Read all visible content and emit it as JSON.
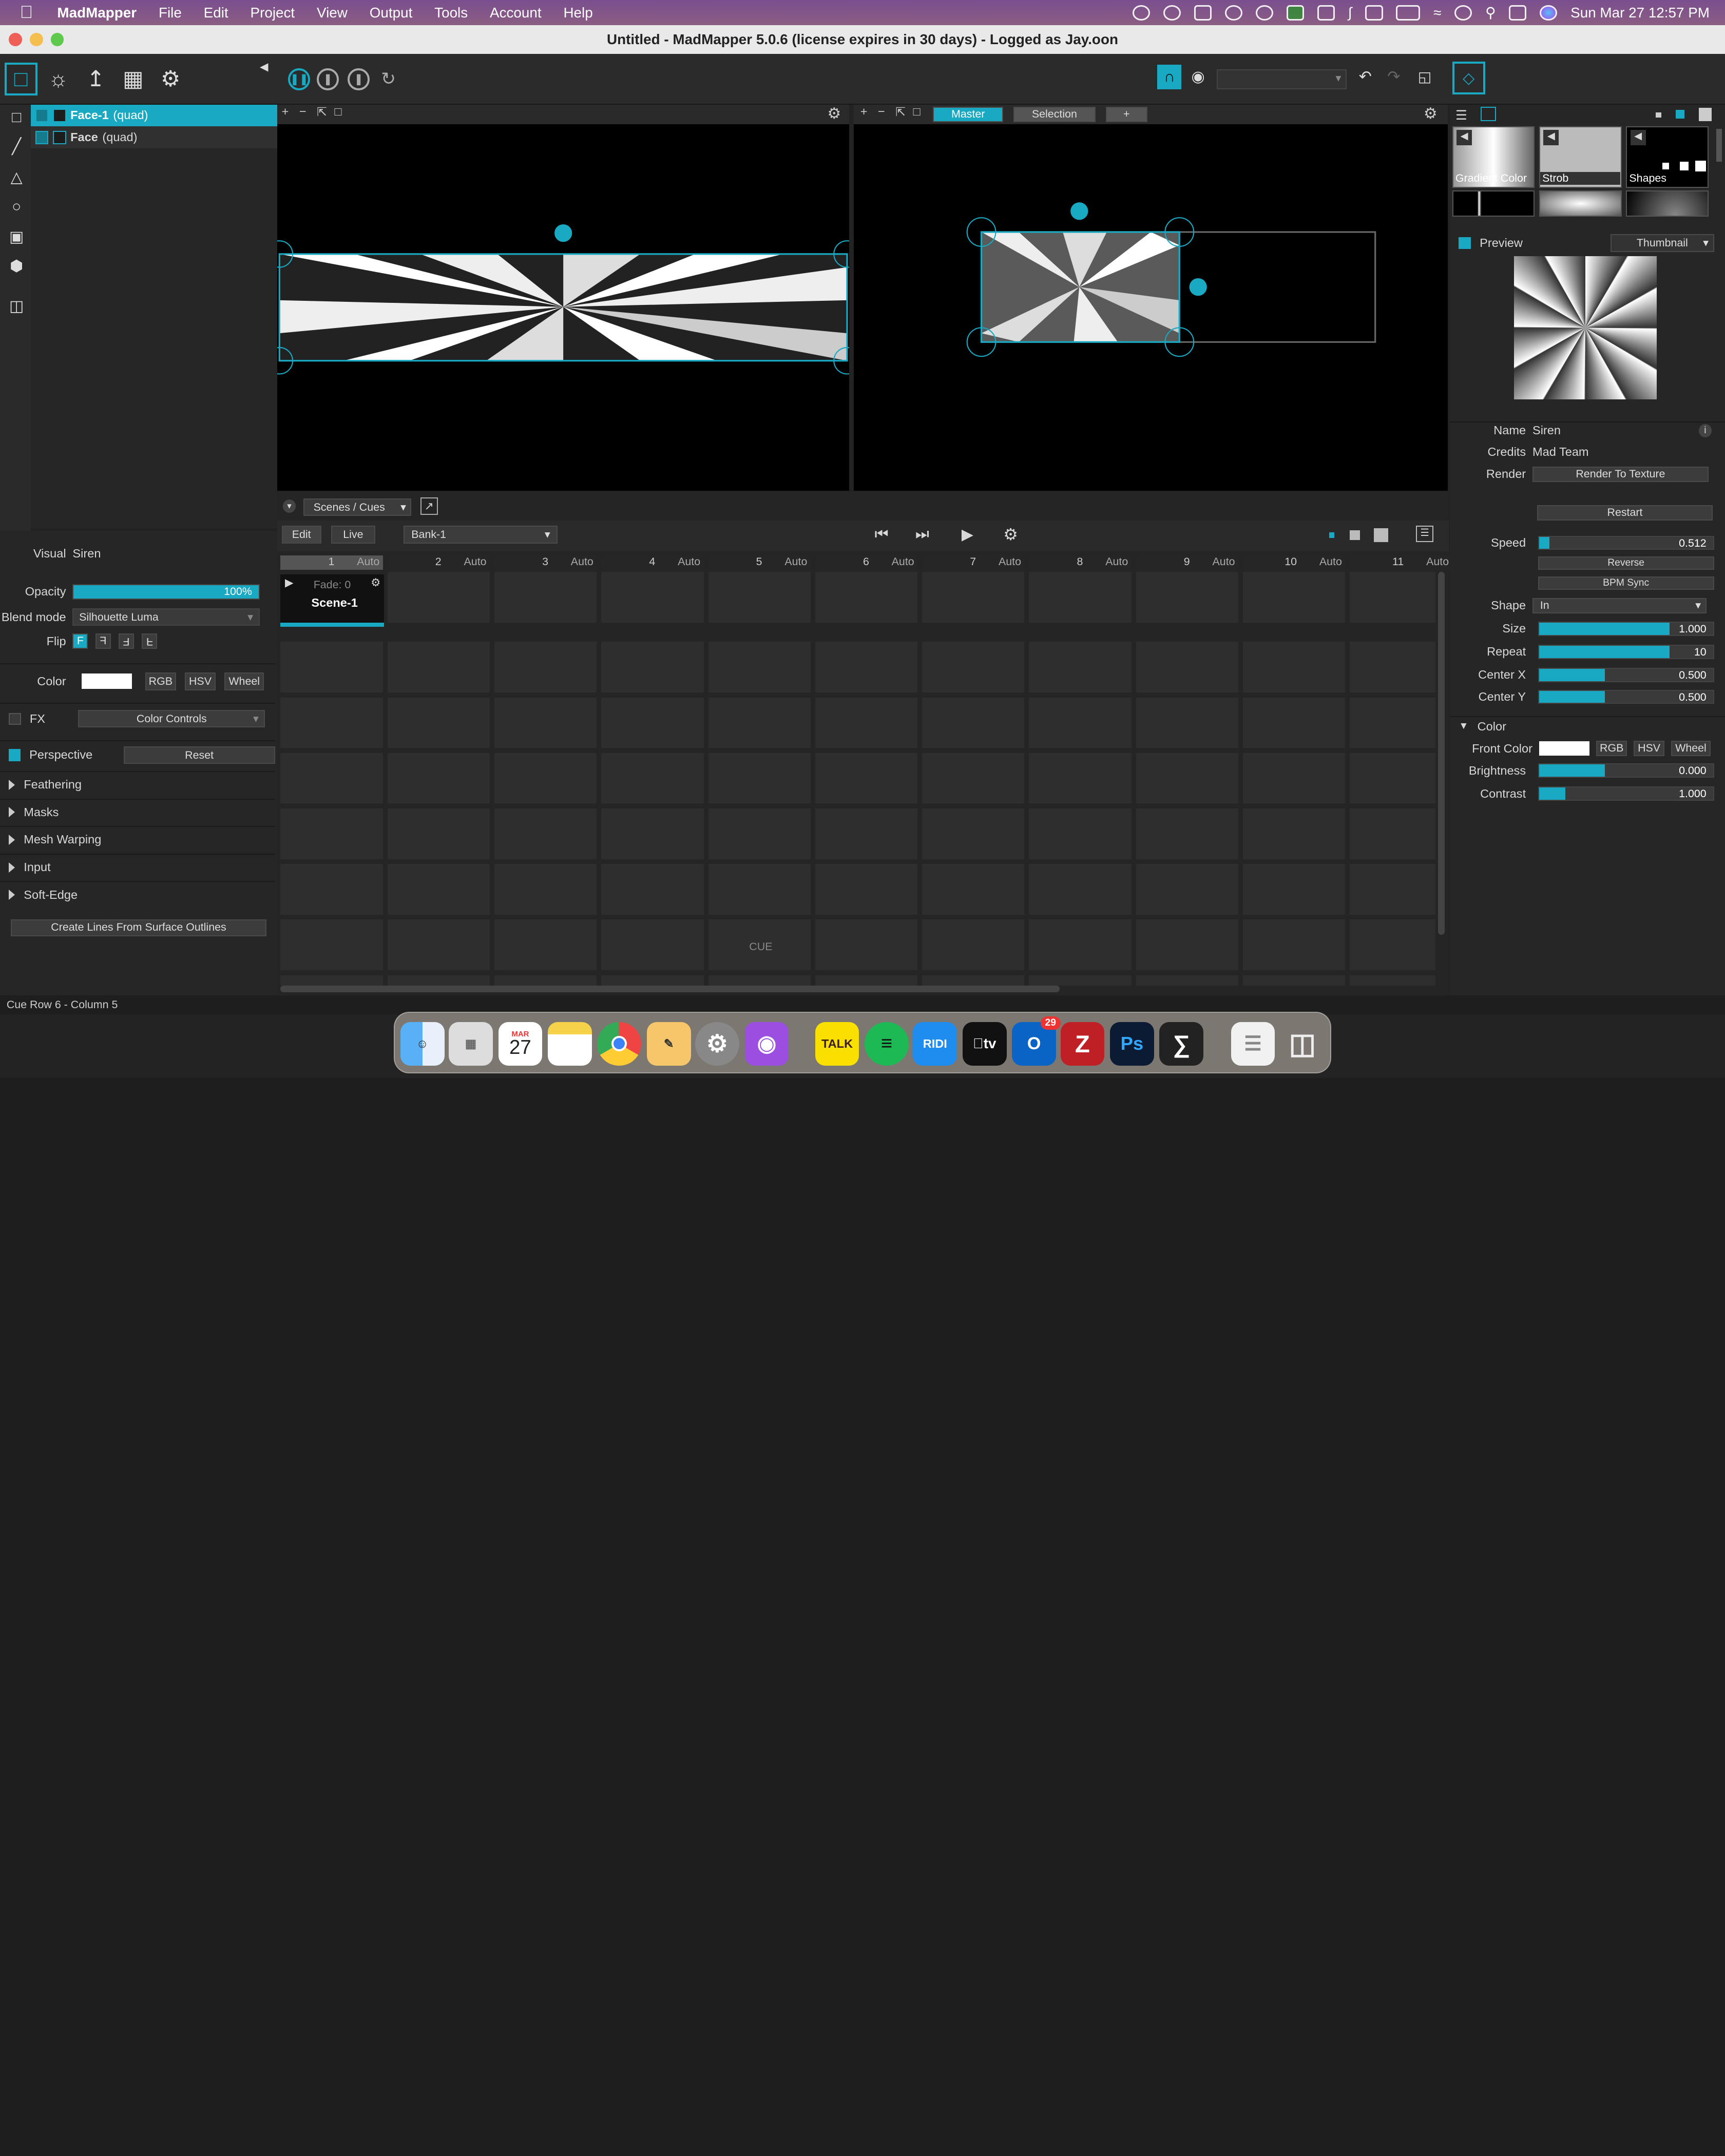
{
  "menubar": {
    "app_name": "MadMapper",
    "items": [
      "File",
      "Edit",
      "Project",
      "View",
      "Output",
      "Tools",
      "Account",
      "Help"
    ],
    "clock": "Sun Mar 27  12:57 PM"
  },
  "window": {
    "title": "Untitled - MadMapper 5.0.6 (license expires in 30 days) - Logged as Jay.oon"
  },
  "layers": [
    {
      "name": "Face-1",
      "type": "(quad)"
    },
    {
      "name": "Face",
      "type": "(quad)"
    }
  ],
  "output_view": {
    "tabs": [
      "Master",
      "Selection",
      "+"
    ]
  },
  "props": {
    "visual_label": "Visual",
    "visual_value": "Siren",
    "opacity_label": "Opacity",
    "opacity_value": "100%",
    "opacity_level": 1.0,
    "blend_label": "Blend mode",
    "blend_value": "Silhouette Luma",
    "flip_label": "Flip",
    "flip_glyphs": [
      "F",
      "F",
      "F",
      "F"
    ],
    "color_label": "Color",
    "color_modes": [
      "RGB",
      "HSV",
      "Wheel"
    ],
    "fx_label": "FX",
    "fx_value": "Color Controls",
    "perspective_label": "Perspective",
    "reset_label": "Reset",
    "sections": [
      "Feathering",
      "Masks",
      "Mesh Warping",
      "Input",
      "Soft-Edge"
    ],
    "create_lines_label": "Create Lines From Surface Outlines"
  },
  "cues": {
    "dropdown": "Scenes / Cues",
    "edit_tab": "Edit",
    "live_tab": "Live",
    "bank": "Bank-1",
    "columns": [
      {
        "num": "1",
        "mode": "Auto"
      },
      {
        "num": "2",
        "mode": "Auto"
      },
      {
        "num": "3",
        "mode": "Auto"
      },
      {
        "num": "4",
        "mode": "Auto"
      },
      {
        "num": "5",
        "mode": "Auto"
      },
      {
        "num": "6",
        "mode": "Auto"
      },
      {
        "num": "7",
        "mode": "Auto"
      },
      {
        "num": "8",
        "mode": "Auto"
      },
      {
        "num": "9",
        "mode": "Auto"
      },
      {
        "num": "10",
        "mode": "Auto"
      },
      {
        "num": "11",
        "mode": "Auto"
      }
    ],
    "scene_fade": "Fade: 0",
    "scene_name": "Scene-1",
    "cue_placeholder": "CUE"
  },
  "library": {
    "items": [
      "Gradient Color",
      "Strob",
      "Shapes"
    ]
  },
  "right": {
    "preview_label": "Preview",
    "preview_mode": "Thumbnail",
    "name_label": "Name",
    "name_value": "Siren",
    "credits_label": "Credits",
    "credits_value": "Mad Team",
    "render_label": "Render",
    "render_button": "Render  To Texture",
    "restart": "Restart",
    "speed_label": "Speed",
    "speed_value": "0.512",
    "speed_level": 0.06,
    "reverse": "Reverse",
    "bpm_sync": "BPM Sync",
    "shape_label": "Shape",
    "shape_value": "In",
    "size_label": "Size",
    "size_value": "1.000",
    "size_level": 0.75,
    "repeat_label": "Repeat",
    "repeat_value": "10",
    "repeat_level": 0.75,
    "centerx_label": "Center X",
    "centerx_value": "0.500",
    "centerx_level": 0.38,
    "centery_label": "Center Y",
    "centery_value": "0.500",
    "centery_level": 0.38,
    "color_section": "Color",
    "front_color_label": "Front Color",
    "color_modes": [
      "RGB",
      "HSV",
      "Wheel"
    ],
    "brightness_label": "Brightness",
    "brightness_value": "0.000",
    "brightness_level": 0.38,
    "contrast_label": "Contrast",
    "contrast_value": "1.000",
    "contrast_level": 0.15
  },
  "status": {
    "text": "Cue Row 6 - Column 5"
  },
  "dock": {
    "calendar_month": "MAR",
    "calendar_day": "27",
    "outlook_badge": "29",
    "app_labels": [
      "TALK",
      "RIDI",
      "tv",
      "Ps"
    ]
  },
  "colors": {
    "accent": "#19a9c2",
    "panel": "#262626",
    "viewport": "#000000"
  }
}
